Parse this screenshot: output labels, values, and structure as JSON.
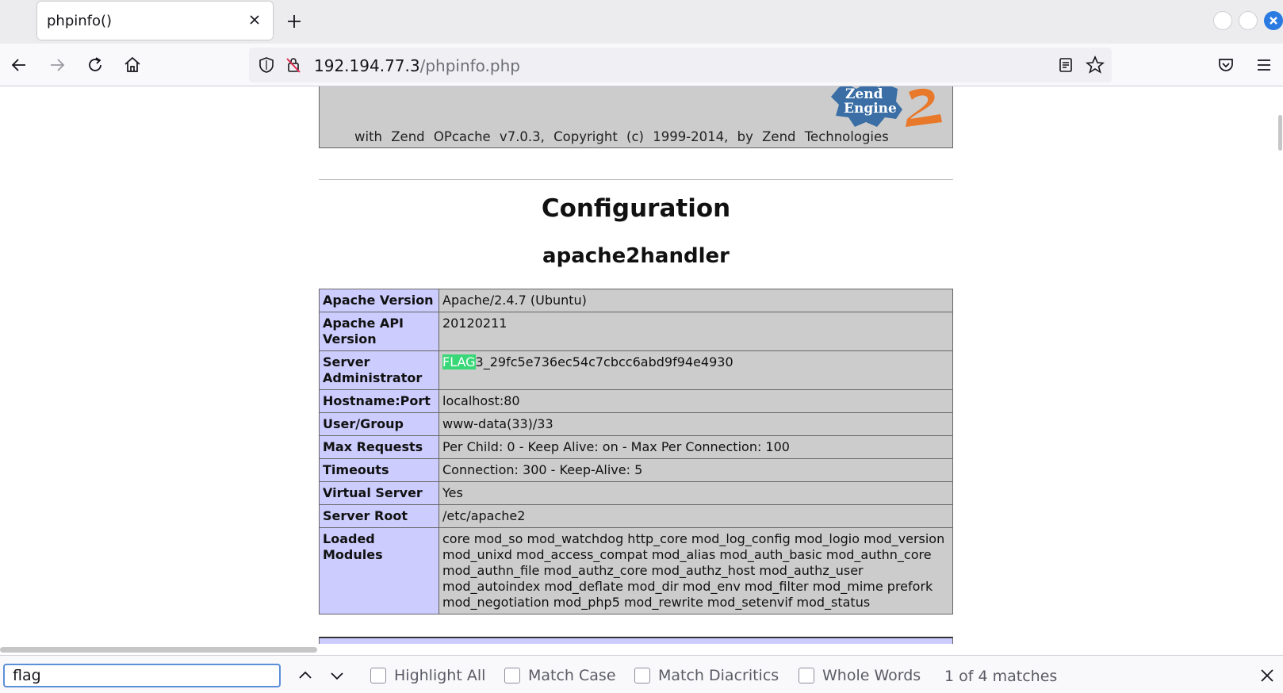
{
  "browser": {
    "tab_title": "phpinfo()",
    "url_host": "192.194.77.3",
    "url_path": "/phpinfo.php"
  },
  "page": {
    "banner_text": "with Zend OPcache v7.0.3, Copyright (c) 1999-2014, by Zend Technologies",
    "zend_logo_text_1": "Zend",
    "zend_logo_text_2": "Engine",
    "zend_logo_number": "2",
    "heading": "Configuration",
    "subheading": "apache2handler",
    "rows": [
      {
        "key": "Apache Version",
        "value": "Apache/2.4.7 (Ubuntu)"
      },
      {
        "key": "Apache API Version",
        "value": "20120211"
      },
      {
        "key": "Server Administrator",
        "value_highlight": "FLAG",
        "value": "3_29fc5e736ec54c7cbcc6abd9f94e4930"
      },
      {
        "key": "Hostname:Port",
        "value": "localhost:80"
      },
      {
        "key": "User/Group",
        "value": "www-data(33)/33"
      },
      {
        "key": "Max Requests",
        "value": "Per Child: 0 - Keep Alive: on - Max Per Connection: 100"
      },
      {
        "key": "Timeouts",
        "value": "Connection: 300 - Keep-Alive: 5"
      },
      {
        "key": "Virtual Server",
        "value": "Yes"
      },
      {
        "key": "Server Root",
        "value": "/etc/apache2"
      },
      {
        "key": "Loaded Modules",
        "value": "core mod_so mod_watchdog http_core mod_log_config mod_logio mod_version mod_unixd mod_access_compat mod_alias mod_auth_basic mod_authn_core mod_authn_file mod_authz_core mod_authz_host mod_authz_user mod_autoindex mod_deflate mod_dir mod_env mod_filter mod_mime prefork mod_negotiation mod_php5 mod_rewrite mod_setenvif mod_status"
      }
    ]
  },
  "findbar": {
    "query": "flag",
    "highlight_all": "Highlight All",
    "match_case": "Match Case",
    "match_diacritics": "Match Diacritics",
    "whole_words": "Whole Words",
    "match_count": "1 of 4 matches"
  },
  "colors": {
    "find_highlight": "#38d878",
    "table_key_bg": "#ccccff",
    "table_value_bg": "#cccccc",
    "accent": "#2a7ae2"
  }
}
